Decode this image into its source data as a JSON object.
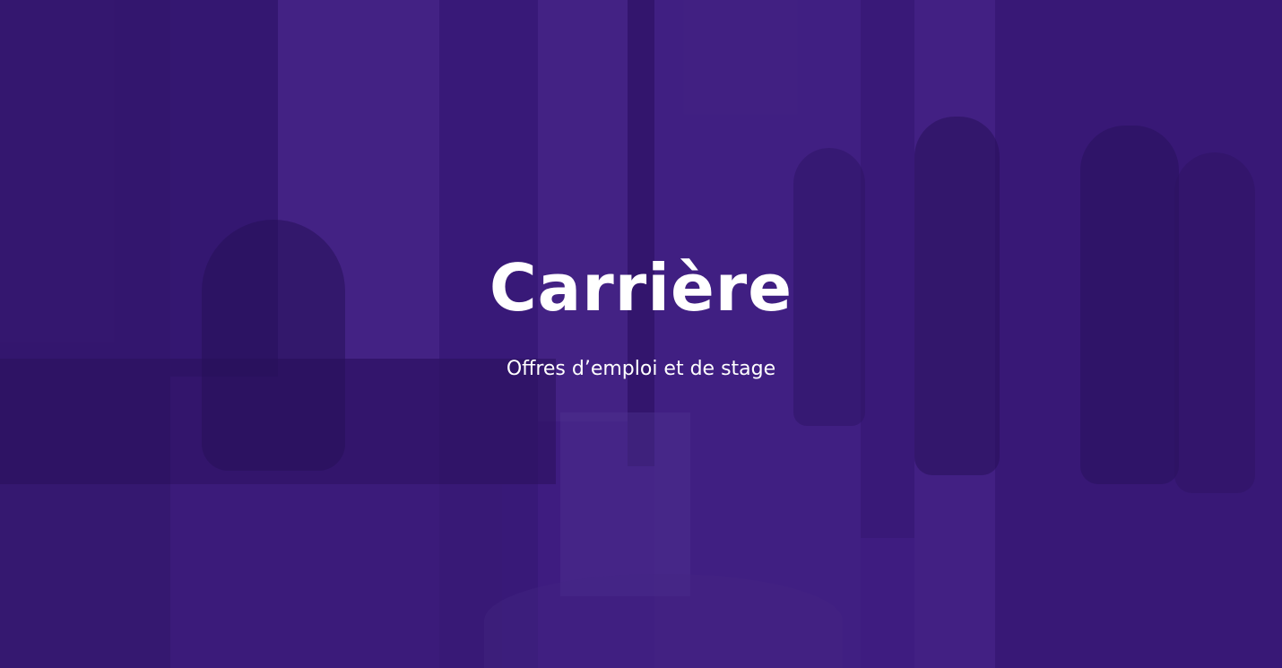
{
  "hero": {
    "title": "Carrière",
    "subtitle": "Offres d’emploi et de stage",
    "background_image": "blurred-office-people-walking",
    "overlay_color": "#3e1c80",
    "text_color": "#ffffff"
  }
}
